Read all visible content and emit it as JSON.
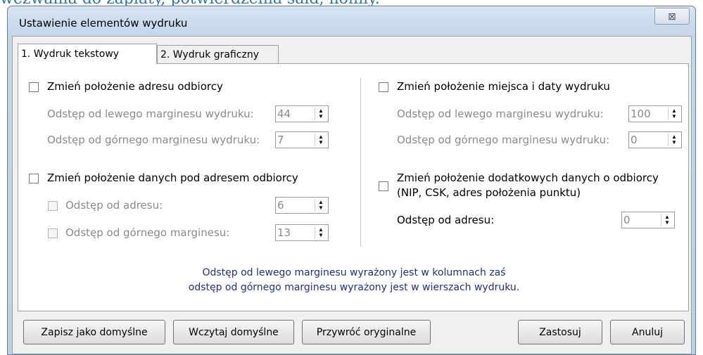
{
  "background_text": "wezwania do zapłaty, potwierdzenia sald, noniły.",
  "window": {
    "title": "Ustawienie elementów wydruku",
    "close_label": "⊠"
  },
  "tabs": [
    {
      "label": "1. Wydruk tekstowy",
      "active": true
    },
    {
      "label": "2. Wydruk graficzny",
      "active": false
    }
  ],
  "left": {
    "address": {
      "checkbox_label": "Zmień położenie adresu odbiorcy",
      "left_margin_label": "Odstęp od lewego marginesu wydruku:",
      "left_margin_value": "44",
      "top_margin_label": "Odstęp od górnego marginesu wydruku:",
      "top_margin_value": "7"
    },
    "data_under": {
      "checkbox_label": "Zmień położenie danych pod adresem odbiorcy",
      "from_address_label": "Odstęp od adresu:",
      "from_address_value": "6",
      "top_margin_label": "Odstęp od górnego marginesu:",
      "top_margin_value": "13"
    }
  },
  "right": {
    "place_date": {
      "checkbox_label": "Zmień położenie miejsca i daty wydruku",
      "left_margin_label": "Odstęp od lewego marginesu wydruku:",
      "left_margin_value": "100",
      "top_margin_label": "Odstęp od górnego marginesu wydruku:",
      "top_margin_value": "0"
    },
    "additional": {
      "checkbox_label_line1": "Zmień położenie dodatkowych danych o odbiorcy",
      "checkbox_label_line2": "(NIP, CSK, adres położenia punktu)",
      "from_address_label": "Odstęp od adresu:",
      "from_address_value": "0"
    }
  },
  "note": {
    "line1": "Odstęp od lewego marginesu wyrażony jest w kolumnach zaś",
    "line2": "odstęp od górnego marginesu wyrażony jest w wierszach wydruku."
  },
  "buttons": {
    "save_default": "Zapisz jako domyślne",
    "load_default": "Wczytaj domyślne",
    "restore_original": "Przywróć oryginalne",
    "apply": "Zastosuj",
    "cancel": "Anuluj"
  },
  "colors": {
    "highlight": "#f7f65a",
    "note_text": "#1f2f8a",
    "background_text": "#2e74b5"
  }
}
